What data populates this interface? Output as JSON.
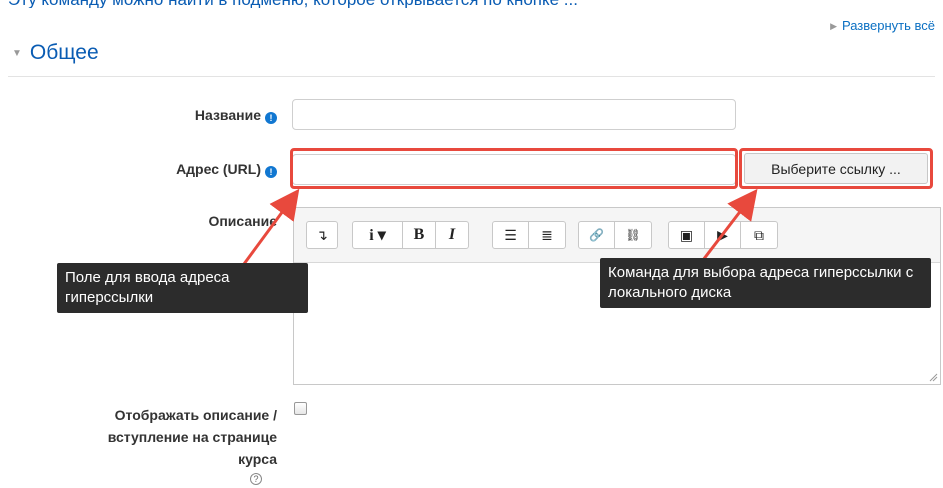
{
  "top_cut_text": "Эту команду можно найти в подменю, которое открывается по кнопке ...",
  "expand_all": "Развернуть всё",
  "section_title": "Общее",
  "fields": {
    "name_label": "Название",
    "url_label": "Адрес (URL)",
    "description_label": "Описание",
    "name_value": "",
    "url_value": ""
  },
  "choose_link_button": "Выберите ссылку ...",
  "toolbar": {
    "collapse": "↴",
    "info_dropdown": "i ▾",
    "bold": "B",
    "italic": "I",
    "unordered_list": "☰",
    "ordered_list": "≣",
    "link": "🔗",
    "unlink": "⛓",
    "image": "▣",
    "media": "▶",
    "manage_files": "⧉"
  },
  "callouts": {
    "url_field": "Поле для ввода адреса гиперссылки",
    "choose_link": "Команда для выбора адреса гиперссылки с локального диска"
  },
  "display_description": {
    "line1": "Отображать описание /",
    "line2": "вступление на странице",
    "line3": "курса"
  },
  "colors": {
    "accent": "#0a5cb3",
    "highlight": "#e8493d",
    "callout_bg": "#2c2c2c",
    "info_icon": "#1177d1"
  }
}
